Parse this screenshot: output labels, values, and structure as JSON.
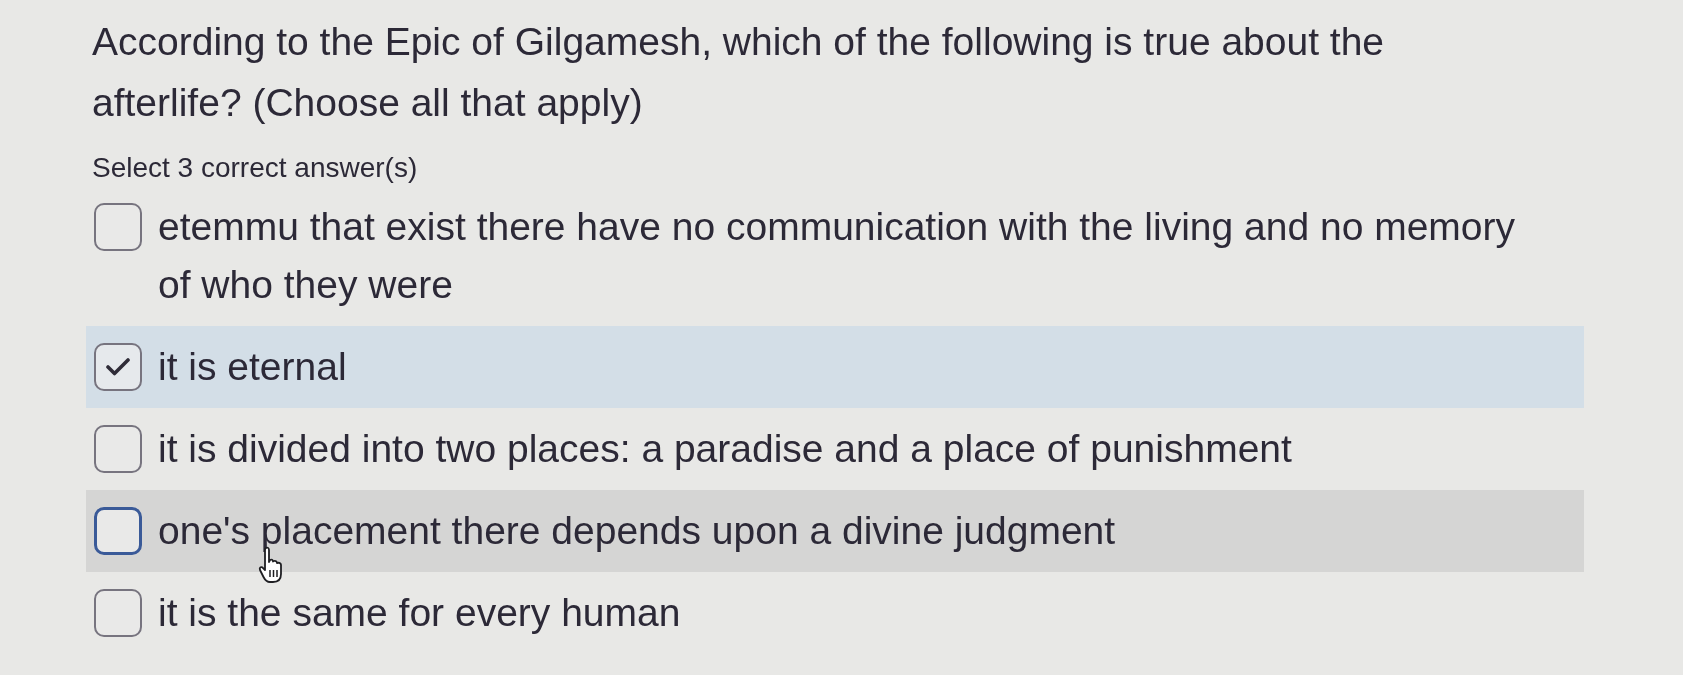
{
  "question": {
    "prompt": "According to the Epic of Gilgamesh, which of the following is true about the afterlife? (Choose all that apply)",
    "instruction": "Select 3 correct answer(s)"
  },
  "options": [
    {
      "text": "etemmu that exist there have no communication with the living and no memory of who they were",
      "checked": false,
      "hovered": false
    },
    {
      "text": "it is eternal",
      "checked": true,
      "hovered": false
    },
    {
      "text": "it is divided into two places: a paradise and a place of punishment",
      "checked": false,
      "hovered": false
    },
    {
      "text": "one's placement there depends upon a divine judgment",
      "checked": false,
      "hovered": true
    },
    {
      "text": "it is the same for every human",
      "checked": false,
      "hovered": false
    }
  ]
}
